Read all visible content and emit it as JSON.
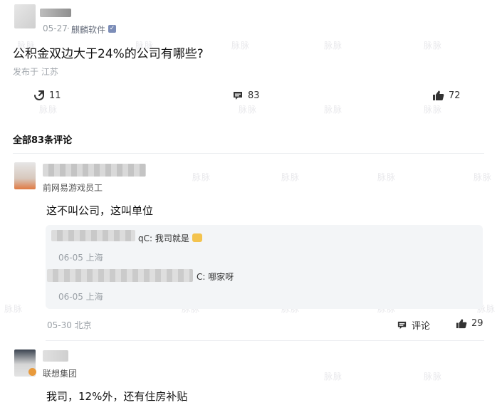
{
  "post": {
    "date": "05-27",
    "source": "麒麟软件",
    "question": "公积金双边大于24%的公司有哪些?",
    "published_in": "发布于 江苏",
    "stats": {
      "forward_count": "11",
      "comment_count": "83",
      "like_count": "72"
    }
  },
  "comments_header": "全部83条评论",
  "comments": [
    {
      "company": "前网易游戏员工",
      "text": "这不叫公司，这叫单位",
      "replies": [
        {
          "prefix": "qC:",
          "text": "我司就是",
          "meta": "06-05 上海"
        },
        {
          "prefix": "C:",
          "text": "哪家呀",
          "meta": "06-05 上海"
        }
      ],
      "meta": "05-30 北京",
      "comment_label": "评论",
      "like_count": "29"
    },
    {
      "company": "联想集团",
      "text": "我司，12%外，还有住房补贴"
    }
  ],
  "watermark": "脉脉",
  "icons": {
    "share": "share-icon",
    "comment": "comment-icon",
    "like": "thumbs-up-icon",
    "verified": "verified-badge-icon",
    "company_badge": "company-badge-icon"
  }
}
